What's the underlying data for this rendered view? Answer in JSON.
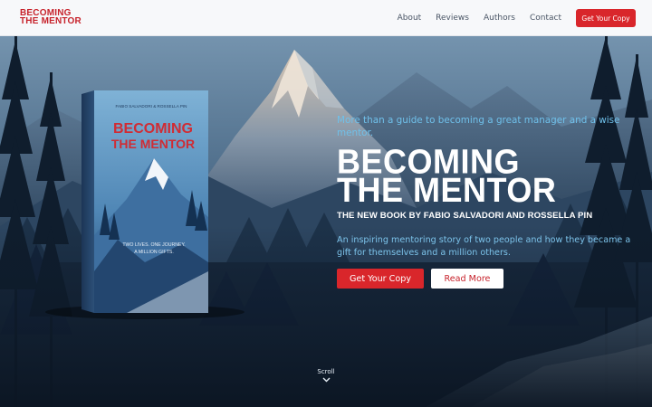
{
  "header": {
    "logo_line1": "BECOMING",
    "logo_line2": "THE MENTOR",
    "nav": [
      "About",
      "Reviews",
      "Authors",
      "Contact"
    ],
    "cta_label": "Get Your Copy"
  },
  "hero": {
    "tagline": "More than a guide to becoming a great manager and a wise mentor.",
    "headline_line1": "BECOMING",
    "headline_line2": "THE MENTOR",
    "byline": "THE NEW BOOK BY FABIO SALVADORI AND ROSSELLA PIN",
    "description": "An inspiring mentoring story of two people and how they became a gift for themselves and a million others.",
    "primary_button": "Get Your Copy",
    "secondary_button": "Read More"
  },
  "book": {
    "authors": "FABIO SALVADORI & ROSSELLA PIN",
    "title_line1": "BECOMING",
    "title_line2": "THE MENTOR",
    "blurb_line1": "TWO LIVES. ONE JOURNEY.",
    "blurb_line2": "A MILLION GIFTS."
  },
  "scroll": {
    "label": "Scroll"
  },
  "colors": {
    "accent": "#d9262b",
    "tagline": "#6fc0ea",
    "sky_top": "#6e8fab",
    "sky_bottom": "#1b2c40"
  }
}
